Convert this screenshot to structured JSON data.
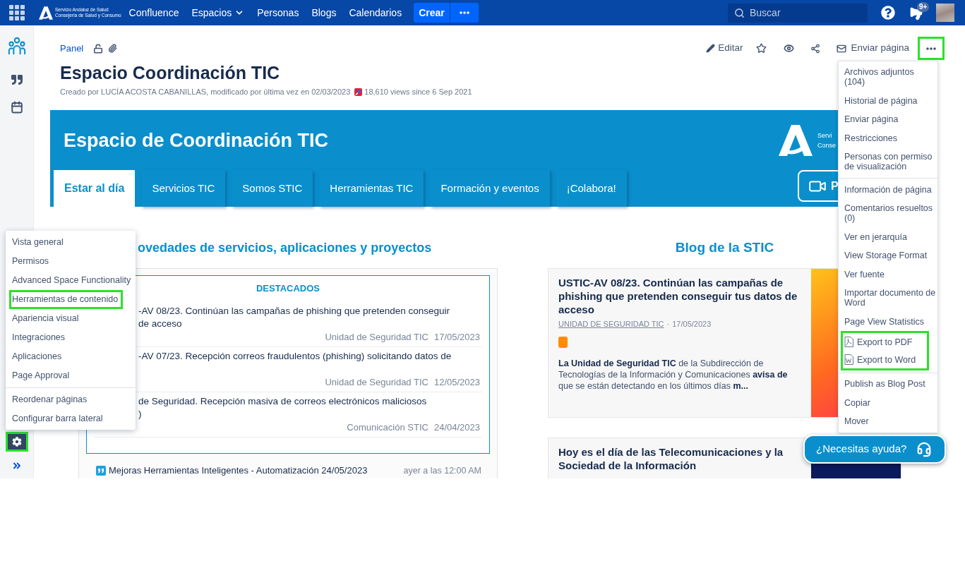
{
  "top_nav": {
    "logo_lines": [
      "Servicio Andaluz de Salud",
      "Consejería de Salud y Consumo"
    ],
    "links": [
      {
        "label": "Confluence",
        "kind": "link"
      },
      {
        "label": "Espacios",
        "kind": "dropdown"
      },
      {
        "label": "Personas",
        "kind": "link"
      },
      {
        "label": "Blogs",
        "kind": "link"
      },
      {
        "label": "Calendarios",
        "kind": "link"
      }
    ],
    "create_button": "Crear",
    "search": {
      "placeholder": "Buscar"
    },
    "notification_count": "9+"
  },
  "space_sidebar": {
    "settings_button": {
      "highlighted": true
    }
  },
  "settings_menu": {
    "sections": [
      {
        "items": [
          {
            "label": "Vista general",
            "highlighted": false
          },
          {
            "label": "Permisos",
            "highlighted": false
          },
          {
            "label": "Advanced Space Functionality",
            "highlighted": false
          },
          {
            "label": "Herramientas de contenido",
            "highlighted": true
          },
          {
            "label": "Apariencia visual",
            "highlighted": false
          },
          {
            "label": "Integraciones",
            "highlighted": false
          },
          {
            "label": "Aplicaciones",
            "highlighted": false
          },
          {
            "label": "Page Approval",
            "highlighted": false
          }
        ]
      },
      {
        "items": [
          {
            "label": "Reordenar páginas",
            "highlighted": false
          },
          {
            "label": "Configurar barra lateral",
            "highlighted": false
          }
        ]
      }
    ]
  },
  "page": {
    "breadcrumb": "Panel",
    "actions": {
      "edit": "Editar",
      "send": "Enviar página",
      "more_button": {
        "highlighted": true
      }
    },
    "title": "Espacio Coordinación TIC",
    "byline": "Creado por LUCÍA ACOSTA CABANILLAS, modificado por última vez en 02/03/2023",
    "views": "18,610 views since 6 Sep 2021"
  },
  "more_menu": {
    "sections": [
      {
        "items": [
          {
            "label": "Archivos adjuntos (104)",
            "kind": "plain",
            "highlighted": false
          },
          {
            "label": "Historial de página",
            "kind": "plain",
            "highlighted": false
          },
          {
            "label": "Enviar página",
            "kind": "plain",
            "highlighted": false
          },
          {
            "label": "Restricciones",
            "kind": "plain",
            "highlighted": false
          },
          {
            "label": "Personas con permiso de visualización",
            "kind": "plain",
            "highlighted": false
          }
        ]
      },
      {
        "items": [
          {
            "label": "Información de página",
            "kind": "plain",
            "highlighted": false
          },
          {
            "label": "Comentarios resueltos (0)",
            "kind": "plain",
            "highlighted": false
          },
          {
            "label": "Ver en jerarquía",
            "kind": "plain",
            "highlighted": false
          },
          {
            "label": "View Storage Format",
            "kind": "plain",
            "highlighted": false
          },
          {
            "label": "Ver fuente",
            "kind": "plain",
            "highlighted": false
          },
          {
            "label": "Importar documento de Word",
            "kind": "plain",
            "highlighted": false
          },
          {
            "label": "Page View Statistics",
            "kind": "plain",
            "highlighted": false
          },
          {
            "label": "Export to PDF",
            "kind": "pdf",
            "highlighted": true
          },
          {
            "label": "Export to Word",
            "kind": "word",
            "highlighted": true
          }
        ]
      },
      {
        "items": [
          {
            "label": "Publish as Blog Post",
            "kind": "plain",
            "highlighted": false
          },
          {
            "label": "Copiar",
            "kind": "plain",
            "highlighted": false
          },
          {
            "label": "Mover",
            "kind": "plain",
            "highlighted": false
          }
        ]
      }
    ]
  },
  "banner": {
    "title": "Espacio de Coordinación TIC",
    "logo_lines": [
      "Servi",
      "Conse"
    ],
    "tabs": [
      {
        "label": "Estar al día",
        "selected": true
      },
      {
        "label": "Servicios TIC",
        "selected": false
      },
      {
        "label": "Somos STIC",
        "selected": false
      },
      {
        "label": "Herramientas TIC",
        "selected": false
      },
      {
        "label": "Formación y eventos",
        "selected": false
      },
      {
        "label": "¡Colabora!",
        "selected": false
      }
    ],
    "video_button": "P"
  },
  "news": {
    "heading": "ovedades de servicios, aplicaciones y proyectos",
    "featured_title": "DESTACADOS",
    "featured": [
      {
        "lines": [
          "-AV 08/23. Continúan las campañas de phishing que pretenden conseguir",
          "de acceso"
        ],
        "source": "Unidad de Seguridad TIC",
        "date": "17/05/2023"
      },
      {
        "lines": [
          "-AV 07/23. Recepción correos fraudulentos (phishing) solicitando datos de"
        ],
        "source": "Unidad de Seguridad TIC",
        "date": "12/05/2023"
      },
      {
        "lines": [
          "de Seguridad. Recepción masiva de correos electrónicos maliciosos",
          ")"
        ],
        "source": "Comunicación STIC",
        "date": "24/04/2023"
      }
    ],
    "recent": [
      {
        "title": "Mejoras Herramientas Inteligentes - Automatización 24/05/2023",
        "time": "ayer a las 12:00 AM"
      }
    ]
  },
  "blog": {
    "heading": "Blog de la STIC",
    "posts": [
      {
        "title": "USTIC-AV 08/23. Continúan las campañas de phishing que pretenden conseguir tus datos de acceso",
        "author": "UNIDAD DE SEGURIDAD TIC",
        "separator": "·",
        "date": "17/05/2023",
        "color": "#ff8b00",
        "excerpt": "**La Unidad de Seguridad TIC** de la Subdirección de Tecnologías de la Información y Comunicaciones **avisa de** que se están detectando en los últimos días **m...**"
      },
      {
        "title": "Hoy es el día de las Telecomunicaciones y la Sociedad de la Información"
      }
    ]
  },
  "help_button": {
    "label": "¿Necesitas ayuda?"
  }
}
